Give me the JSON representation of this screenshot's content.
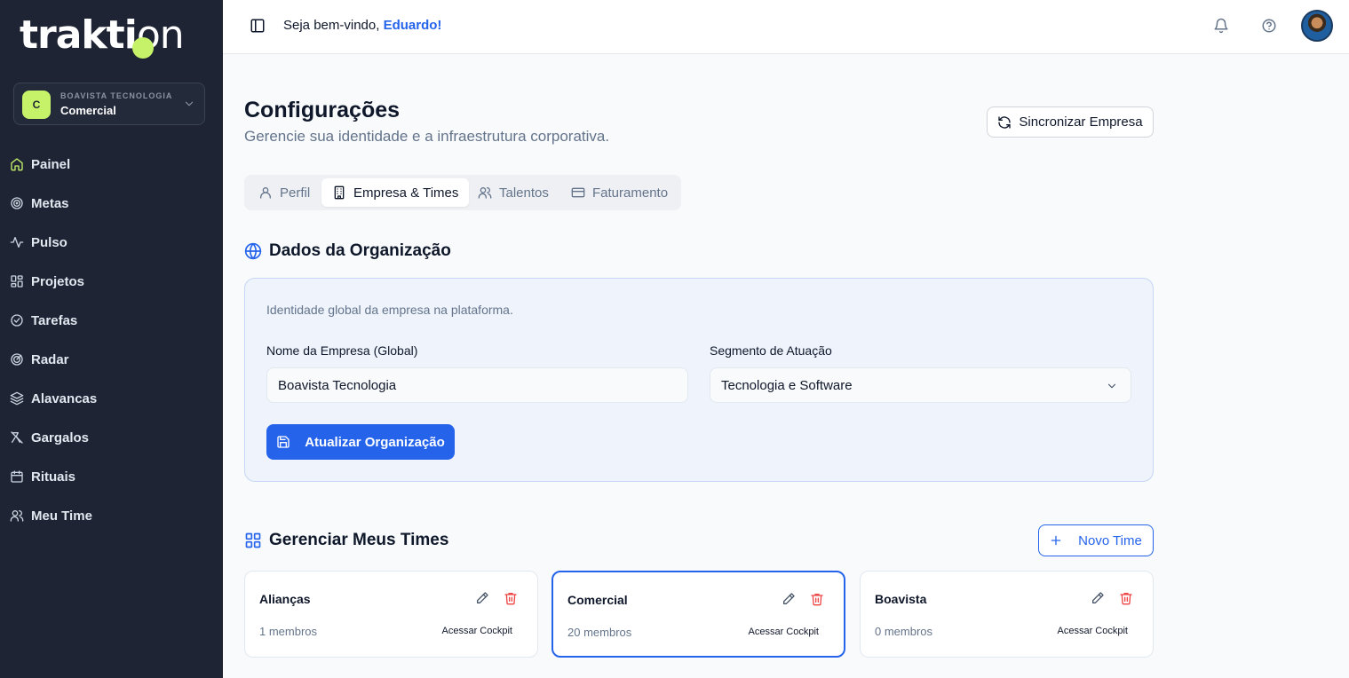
{
  "sidebar": {
    "logo_main": "trakti",
    "logo_tail": "on",
    "org": {
      "badge": "C",
      "company": "BOAVISTA TECNOLOGIA",
      "team": "Comercial"
    },
    "items": [
      {
        "label": "Painel",
        "icon": "home-icon"
      },
      {
        "label": "Metas",
        "icon": "target-icon"
      },
      {
        "label": "Pulso",
        "icon": "activity-icon"
      },
      {
        "label": "Projetos",
        "icon": "grid-icon"
      },
      {
        "label": "Tarefas",
        "icon": "check-circle-icon"
      },
      {
        "label": "Radar",
        "icon": "radar-icon"
      },
      {
        "label": "Alavancas",
        "icon": "layers-icon"
      },
      {
        "label": "Gargalos",
        "icon": "bottleneck-icon"
      },
      {
        "label": "Rituais",
        "icon": "calendar-icon"
      },
      {
        "label": "Meu Time",
        "icon": "users-icon"
      }
    ]
  },
  "header": {
    "welcome": "Seja bem-vindo,",
    "user": "Eduardo!"
  },
  "page": {
    "title": "Configurações",
    "subtitle": "Gerencie sua identidade e a infraestrutura corporativa.",
    "sync_label": "Sincronizar Empresa"
  },
  "tabs": [
    {
      "label": "Perfil"
    },
    {
      "label": "Empresa & Times"
    },
    {
      "label": "Talentos"
    },
    {
      "label": "Faturamento"
    }
  ],
  "org_section": {
    "title": "Dados da Organização",
    "description": "Identidade global da empresa na plataforma.",
    "name_label": "Nome da Empresa (Global)",
    "name_value": "Boavista Tecnologia",
    "segment_label": "Segmento de Atuação",
    "segment_value": "Tecnologia e Software",
    "update_label": "Atualizar Organização"
  },
  "teams_section": {
    "title": "Gerenciar Meus Times",
    "new_label": "Novo Time",
    "teams": [
      {
        "name": "Alianças",
        "members": "1 membros",
        "cockpit": "Acessar Cockpit"
      },
      {
        "name": "Comercial",
        "members": "20 membros",
        "cockpit": "Acessar Cockpit"
      },
      {
        "name": "Boavista",
        "members": "0 membros",
        "cockpit": "Acessar Cockpit"
      }
    ]
  },
  "colors": {
    "sidebar_bg": "#1e2433",
    "accent_lime": "#c6f26a",
    "primary_blue": "#2563eb",
    "danger_red": "#ef4444"
  }
}
